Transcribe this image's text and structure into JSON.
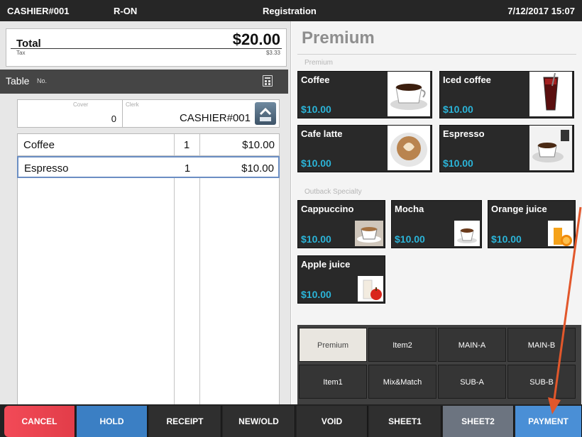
{
  "status_bar": {
    "cashier": "CASHIER#001",
    "mode": "R-ON",
    "screen": "Registration",
    "datetime": "7/12/2017 15:07"
  },
  "totals": {
    "total_label": "Total",
    "total_value": "$20.00",
    "tax_label": "Tax",
    "tax_value": "$3.33"
  },
  "table_bar": {
    "label": "Table",
    "no_label": "No.",
    "icon": "calculator-icon"
  },
  "cover_clerk": {
    "cover_label": "Cover",
    "cover_value": "0",
    "clerk_label": "Clerk",
    "clerk_value": "CASHIER#001",
    "clerk_button_icon": "chevron-up-icon"
  },
  "order_items": [
    {
      "name": "Coffee",
      "qty": "1",
      "price": "$10.00",
      "selected": false
    },
    {
      "name": "Espresso",
      "qty": "1",
      "price": "$10.00",
      "selected": true
    }
  ],
  "category": {
    "title": "Premium",
    "section1_label": "Premium",
    "section2_label": "Outback Specialty"
  },
  "items": [
    {
      "name": "Coffee",
      "price": "$10.00",
      "image": "coffee-cup-image"
    },
    {
      "name": "Iced coffee",
      "price": "$10.00",
      "image": "iced-coffee-image"
    },
    {
      "name": "Cafe latte",
      "price": "$10.00",
      "image": "latte-art-image"
    },
    {
      "name": "Espresso",
      "price": "$10.00",
      "image": "espresso-cup-image"
    },
    {
      "name": "Cappuccino",
      "price": "$10.00",
      "image": "cappuccino-image"
    },
    {
      "name": "Mocha",
      "price": "$10.00",
      "image": "mocha-image"
    },
    {
      "name": "Orange juice",
      "price": "$10.00",
      "image": "orange-juice-image"
    },
    {
      "name": "Apple juice",
      "price": "$10.00",
      "image": "apple-juice-image"
    }
  ],
  "tabs": [
    {
      "label": "Premium",
      "active": true
    },
    {
      "label": "Item2",
      "active": false
    },
    {
      "label": "MAIN-A",
      "active": false
    },
    {
      "label": "MAIN-B",
      "active": false
    },
    {
      "label": "Item1",
      "active": false
    },
    {
      "label": "Mix&Match",
      "active": false
    },
    {
      "label": "SUB-A",
      "active": false
    },
    {
      "label": "SUB-B",
      "active": false
    }
  ],
  "bottom_buttons": [
    {
      "label": "CANCEL",
      "color": "#e5484d"
    },
    {
      "label": "HOLD",
      "color": "#3b7fc4"
    },
    {
      "label": "RECEIPT",
      "color": "#2f2f2f"
    },
    {
      "label": "NEW/OLD",
      "color": "#2f2f2f"
    },
    {
      "label": "VOID",
      "color": "#2f2f2f"
    },
    {
      "label": "SHEET1",
      "color": "#2f2f2f"
    },
    {
      "label": "SHEET2",
      "color": "#6c7480"
    },
    {
      "label": "PAYMENT",
      "color": "#4a8fd6"
    }
  ],
  "colors": {
    "accent_price": "#2bb4d8",
    "annotation_arrow": "#e2572b"
  }
}
